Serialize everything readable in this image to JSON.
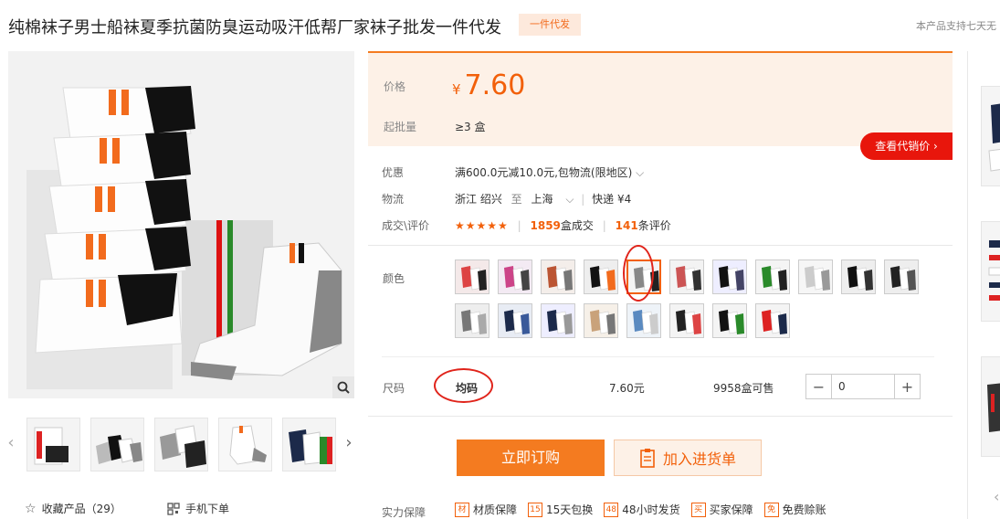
{
  "product": {
    "title": "纯棉袜子男士船袜夏季抗菌防臭运动吸汗低帮厂家袜子批发一件代发",
    "dropship_badge": "一件代发",
    "support_text": "本产品支持七天无"
  },
  "price": {
    "label": "价格",
    "currency": "¥",
    "value": "7.60",
    "moq_label": "起批量",
    "moq_value": "≥3 盒",
    "view_price_button": "查看代销价 ›"
  },
  "info": {
    "promo_label": "优惠",
    "promo_value": "满600.0元减10.0元,包物流(限地区)",
    "logistics_label": "物流",
    "logistics_from": "浙江 绍兴",
    "logistics_to_word": "至",
    "logistics_to": "上海",
    "logistics_express": "快递 ¥4",
    "deals_label": "成交\\评价",
    "rating_stars": "★★★★★",
    "deals_count": "1859",
    "deals_unit": "盒成交",
    "review_count": "141",
    "review_unit": "条评价"
  },
  "colors": {
    "label": "颜色",
    "selected_index": 4,
    "swatch_count": 19
  },
  "size": {
    "label": "尺码",
    "value": "均码",
    "price": "7.60元",
    "stock": "9958盒可售",
    "quantity": "0",
    "minus": "−",
    "plus": "+"
  },
  "actions": {
    "buy_now": "立即订购",
    "add_to_list": "加入进货单"
  },
  "guarantees": {
    "label": "实力保障",
    "items": [
      {
        "icon_text": "材",
        "label": "材质保障"
      },
      {
        "icon_text": "15",
        "label": "15天包换"
      },
      {
        "icon_text": "48",
        "label": "48小时发货"
      },
      {
        "icon_text": "买",
        "label": "买家保障"
      },
      {
        "icon_text": "免",
        "label": "免费赊账"
      }
    ]
  },
  "gallery": {
    "favorite_label": "收藏产品（29）",
    "mobile_label": "手机下单"
  },
  "colors_palette": {
    "accent": "#f2600a",
    "buy_button": "#f47b20",
    "price_bg": "#fdf1e7",
    "annotation": "#e0241b"
  }
}
